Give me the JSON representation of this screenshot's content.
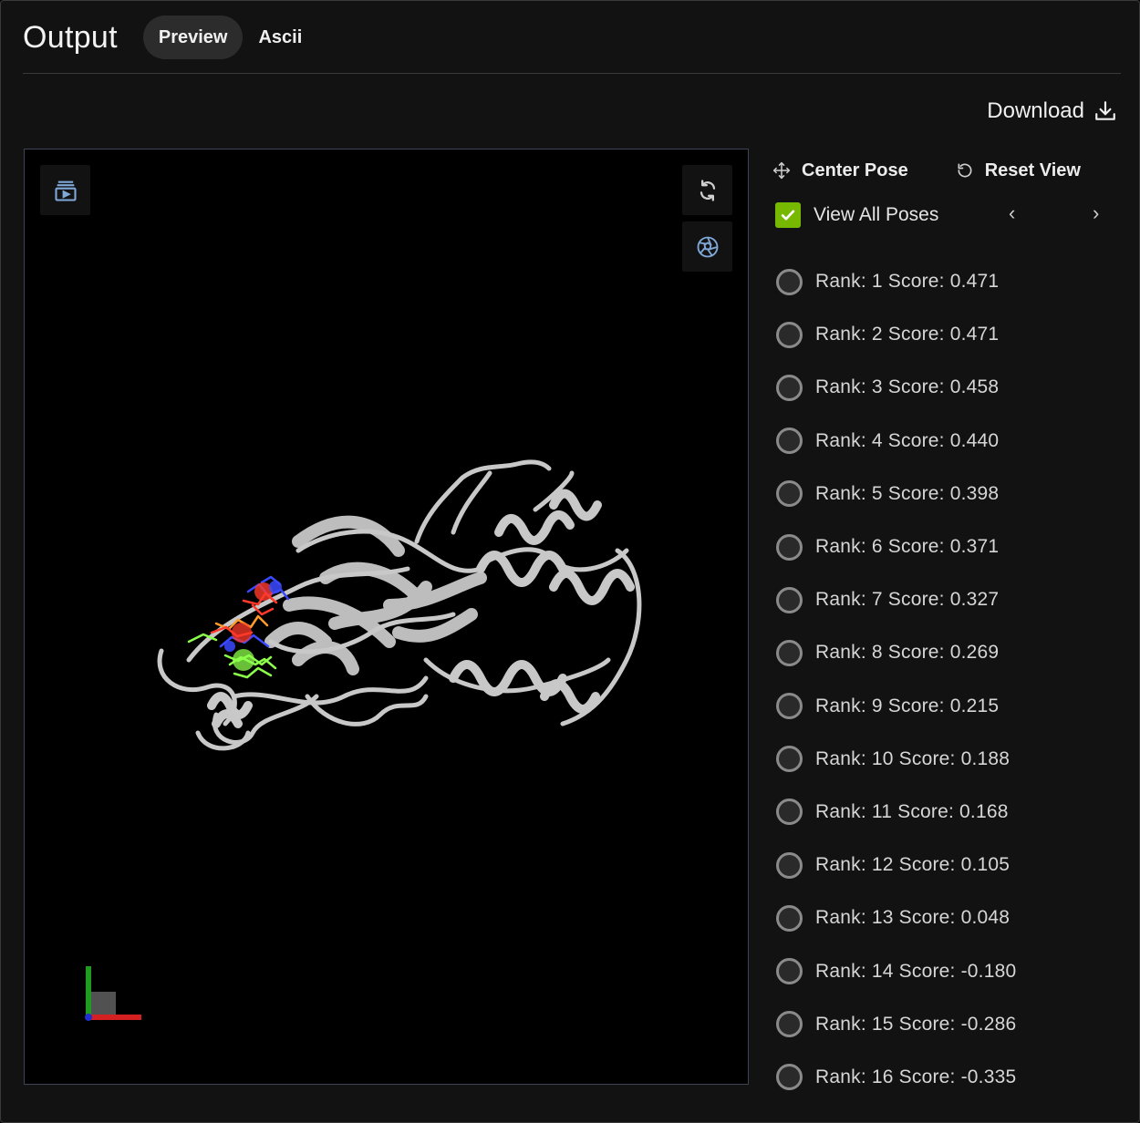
{
  "header": {
    "title": "Output",
    "tabs": [
      {
        "label": "Preview",
        "active": true
      },
      {
        "label": "Ascii",
        "active": false
      }
    ]
  },
  "download": {
    "label": "Download",
    "icon": "download-icon"
  },
  "viewer": {
    "buttons": [
      "playlist-icon",
      "rotate-icon",
      "aperture-icon"
    ],
    "ligand_colors": [
      "#3a49ff",
      "#ff3a2a",
      "#8cff4a",
      "#ff9b2a"
    ],
    "protein_color": "#c8c8c8",
    "axis_colors": {
      "x": "#d42020",
      "y": "#1f9b1f",
      "z": "#2030d0"
    }
  },
  "controls": {
    "center_pose": "Center Pose",
    "reset_view": "Reset View",
    "view_all": {
      "label": "View All Poses",
      "checked": true
    },
    "prev": "‹",
    "next": "›",
    "accent": "#76b900"
  },
  "poses": [
    {
      "label": "Rank: 1 Score: 0.471"
    },
    {
      "label": "Rank: 2 Score: 0.471"
    },
    {
      "label": "Rank: 3 Score: 0.458"
    },
    {
      "label": "Rank: 4 Score: 0.440"
    },
    {
      "label": "Rank: 5 Score: 0.398"
    },
    {
      "label": "Rank: 6 Score: 0.371"
    },
    {
      "label": "Rank: 7 Score: 0.327"
    },
    {
      "label": "Rank: 8 Score: 0.269"
    },
    {
      "label": "Rank: 9 Score: 0.215"
    },
    {
      "label": "Rank: 10 Score: 0.188"
    },
    {
      "label": "Rank: 11 Score: 0.168"
    },
    {
      "label": "Rank: 12 Score: 0.105"
    },
    {
      "label": "Rank: 13 Score: 0.048"
    },
    {
      "label": "Rank: 14 Score: -0.180"
    },
    {
      "label": "Rank: 15 Score: -0.286"
    },
    {
      "label": "Rank: 16 Score: -0.335"
    }
  ]
}
